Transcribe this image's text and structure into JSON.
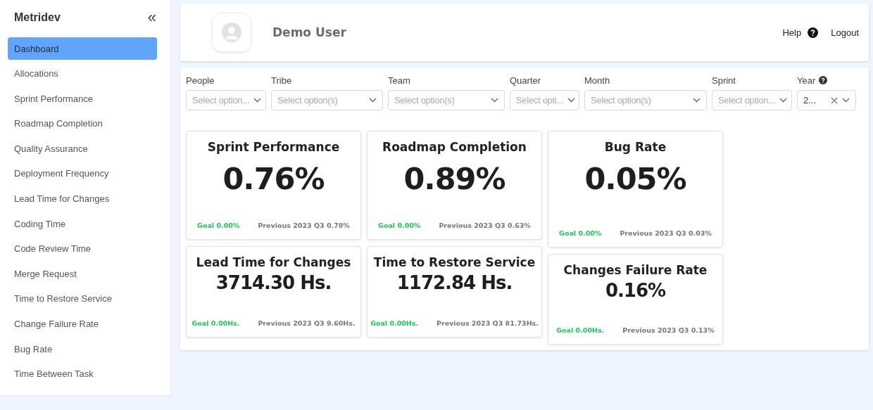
{
  "sidebar": {
    "brand": "Metridev",
    "collapse_icon": "«",
    "items": [
      {
        "label": "Dashboard",
        "selected": true
      },
      {
        "label": "Allocations",
        "selected": false
      },
      {
        "label": "Sprint Performance",
        "selected": false
      },
      {
        "label": "Roadmap Completion",
        "selected": false
      },
      {
        "label": "Quality Assurance",
        "selected": false
      },
      {
        "label": "Deployment Frequency",
        "selected": false
      },
      {
        "label": "Lead Time for Changes",
        "selected": false
      },
      {
        "label": "Coding Time",
        "selected": false
      },
      {
        "label": "Code Review Time",
        "selected": false
      },
      {
        "label": "Merge Request",
        "selected": false
      },
      {
        "label": "Time to Restore Service",
        "selected": false
      },
      {
        "label": "Change Failure Rate",
        "selected": false
      },
      {
        "label": "Bug Rate",
        "selected": false
      },
      {
        "label": "Time Between Task",
        "selected": false
      }
    ]
  },
  "header": {
    "user_name": "Demo User",
    "help": "Help",
    "logout": "Logout"
  },
  "filters": [
    {
      "label": "People",
      "placeholder": "Select option..."
    },
    {
      "label": "Tribe",
      "placeholder": "Select option(s)"
    },
    {
      "label": "Team",
      "placeholder": "Select option(s)"
    },
    {
      "label": "Quarter",
      "placeholder": "Select opti..."
    },
    {
      "label": "Month",
      "placeholder": "Select option(s)"
    },
    {
      "label": "Sprint",
      "placeholder": "Select option..."
    },
    {
      "label": "Year",
      "value": "2...",
      "help": true,
      "clearable": true
    }
  ],
  "metric_columns": [
    [
      {
        "title": "Sprint Performance",
        "value": "0.76%",
        "goal": "Goal 0.00%",
        "previous": "Previous 2023 Q3 0.78%"
      },
      {
        "title": "Lead Time for Changes",
        "value": "3714.30 Hs.",
        "goal": "Goal 0.00Hs.",
        "previous": "Previous 2023 Q3 9.60Hs."
      }
    ],
    [
      {
        "title": "Roadmap Completion",
        "value": "0.89%",
        "goal": "Goal 0.00%",
        "previous": "Previous 2023 Q3 0.63%"
      },
      {
        "title": "Time to Restore Service",
        "value": "1172.84 Hs.",
        "goal": "Goal 0.00Hs.",
        "previous": "Previous 2023 Q3 81.73Hs."
      }
    ],
    [
      {
        "title": "Bug Rate",
        "value": "0.05%",
        "goal": "Goal 0.00%",
        "previous": "Previous 2023 Q3 0.03%"
      },
      {
        "title": "Changes Failure Rate",
        "value": "0.16%",
        "goal": "Goal 0.00Hs.",
        "previous": "Previous 2023 Q3 0.13%"
      }
    ]
  ]
}
